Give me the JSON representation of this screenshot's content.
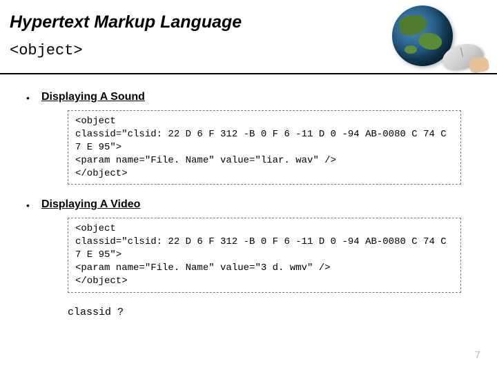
{
  "header": {
    "title": "Hypertext Markup Language",
    "subtitle": "<object>"
  },
  "sections": [
    {
      "heading": "Displaying A Sound",
      "code": "<object\nclassid=\"clsid: 22 D 6 F 312 -B 0 F 6 -11 D 0 -94 AB-0080 C 74 C 7 E 95\">\n<param name=\"File. Name\" value=\"liar. wav\" />\n</object>"
    },
    {
      "heading": "Displaying A Video",
      "code": "<object\nclassid=\"clsid: 22 D 6 F 312 -B 0 F 6 -11 D 0 -94 AB-0080 C 74 C 7 E 95\">\n<param name=\"File. Name\" value=\"3 d. wmv\" />\n</object>"
    }
  ],
  "footnote": "classid ?",
  "page_number": "7"
}
